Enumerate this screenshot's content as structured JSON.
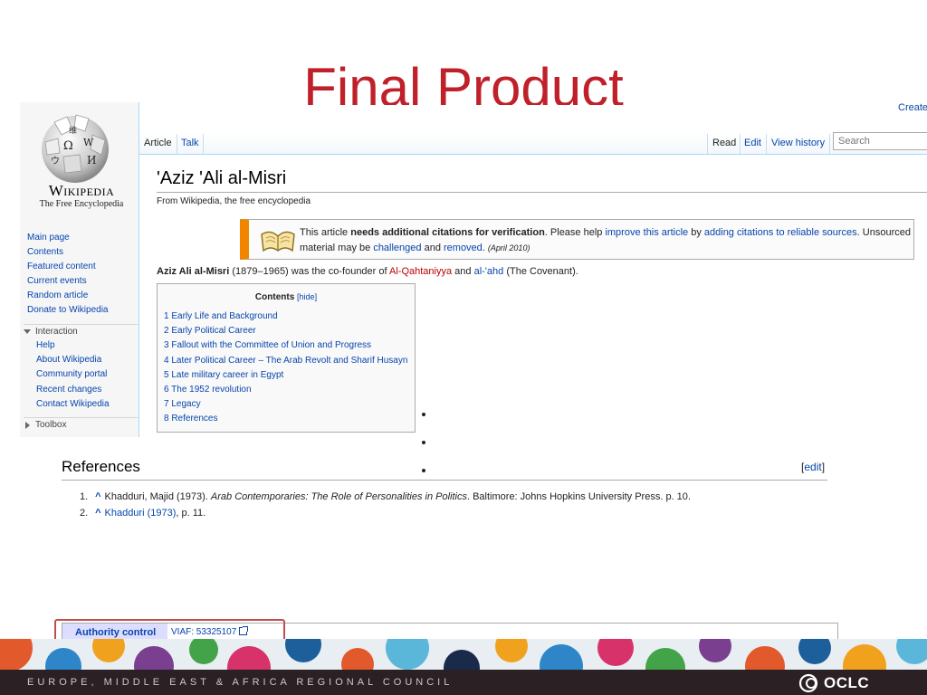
{
  "slide": {
    "title": "Final Product",
    "footer": "EUROPE, MIDDLE EAST & AFRICA REGIONAL COUNCIL",
    "brand": "OCLC"
  },
  "wiki": {
    "create_link": "Create",
    "logo": {
      "wordmark": "Wikipedia",
      "tagline": "The Free Encyclopedia"
    },
    "nav": [
      "Main page",
      "Contents",
      "Featured content",
      "Current events",
      "Random article",
      "Donate to Wikipedia"
    ],
    "interaction": {
      "label": "Interaction",
      "items": [
        "Help",
        "About Wikipedia",
        "Community portal",
        "Recent changes",
        "Contact Wikipedia"
      ]
    },
    "toolbox": {
      "label": "Toolbox"
    },
    "tabs": {
      "article": "Article",
      "talk": "Talk",
      "read": "Read",
      "edit": "Edit",
      "view_history": "View history"
    },
    "search": {
      "placeholder": "Search"
    },
    "page": {
      "title": "'Aziz 'Ali al-Misri",
      "from": "From Wikipedia, the free encyclopedia"
    },
    "notice": {
      "t1": "This article ",
      "bold": "needs additional citations for verification",
      "t2": ". Please help ",
      "link1": "improve this article",
      "t3": " by ",
      "link2": "adding citations to reliable sources",
      "t4": ". Unsourced material may be ",
      "link3": "challenged",
      "t5": " and ",
      "link4": "removed",
      "t6": ".",
      "date": "(April 2010)"
    },
    "lead": {
      "bold": "Aziz Ali al-Misri",
      "t1": " (1879–1965) was the co-founder of ",
      "link1": "Al-Qahtaniyya",
      "t2": " and ",
      "link2": "al-'ahd",
      "t3": " (The Covenant)."
    },
    "toc": {
      "title": "Contents",
      "hide": "[hide]",
      "items": [
        "1 Early Life and Background",
        "2 Early Political Career",
        "3 Fallout with the Committee of Union and Progress",
        "4 Later Political Career – The Arab Revolt and Sharif Husayn",
        "5 Late military career in Egypt",
        "6 The 1952 revolution",
        "7 Legacy",
        "8 References"
      ]
    },
    "references": {
      "heading": "References",
      "edit_open": "[",
      "edit": "edit",
      "edit_close": "]",
      "items": [
        {
          "num": "1.",
          "caret": "^",
          "author": "Khadduri, Majid (1973). ",
          "title": "Arab Contemporaries: The Role of Personalities in Politics",
          "rest": ". Baltimore: Johns Hopkins University Press. p. 10."
        },
        {
          "num": "2.",
          "caret": "^",
          "link": "Khadduri (1973)",
          "rest": ", p. 11."
        }
      ]
    },
    "authority": {
      "label": "Authority control",
      "value": "VIAF: 53325107"
    }
  },
  "colors": {
    "title_red": "#c0202a",
    "link_blue": "#0645ad",
    "notice_orange": "#f28500",
    "footer_band": "#2b2024",
    "highlight": "#c0504d"
  }
}
